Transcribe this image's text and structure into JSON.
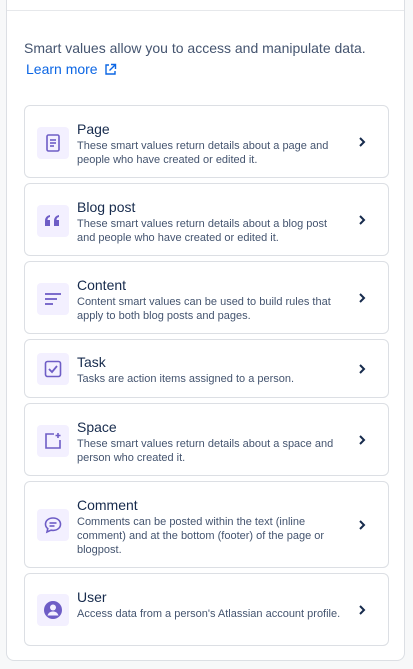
{
  "intro": {
    "text": "Smart values allow you to access and manipulate data.",
    "learn_more": "Learn more"
  },
  "items": [
    {
      "title": "Page",
      "description": "These smart values return details about a page and people who have created or edited it.",
      "icon": "page-icon"
    },
    {
      "title": "Blog post",
      "description": "These smart values return details about a blog post and people who have created or edited it.",
      "icon": "quote-icon"
    },
    {
      "title": "Content",
      "description": "Content smart values can be used to build rules that apply to both blog posts and pages.",
      "icon": "content-icon"
    },
    {
      "title": "Task",
      "description": "Tasks are action items assigned to a person.",
      "icon": "task-checkbox-icon"
    },
    {
      "title": "Space",
      "description": "These smart values return details about a space and person who created it.",
      "icon": "space-icon"
    },
    {
      "title": "Comment",
      "description": "Comments can be posted within the text (inline comment) and at the bottom (footer) of the page or blogpost.",
      "icon": "comment-icon"
    },
    {
      "title": "User",
      "description": "Access data from a person's Atlassian account profile.",
      "icon": "user-icon"
    }
  ],
  "colors": {
    "accent": "#6e5dc6",
    "icon_bg": "#f3f0ff",
    "link": "#0c66e4",
    "text": "#172b4d",
    "subtle_text": "#44546f"
  }
}
